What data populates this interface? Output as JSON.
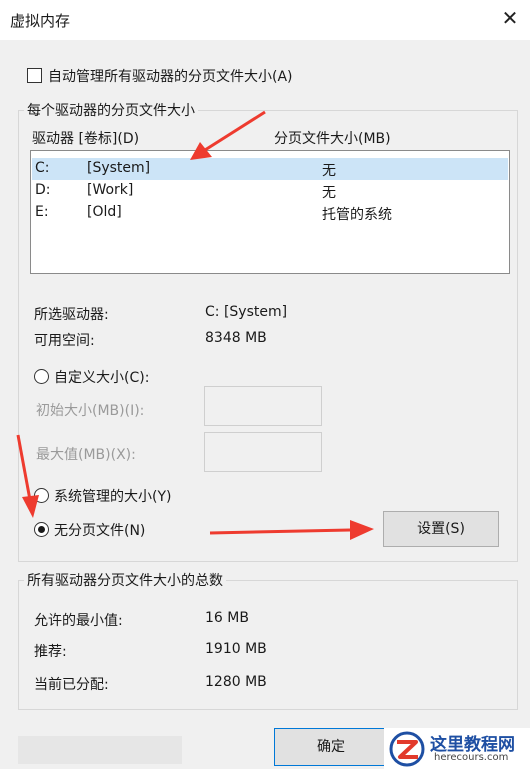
{
  "window": {
    "title": "虚拟内存",
    "close_glyph": "✕"
  },
  "auto_manage": {
    "label": "自动管理所有驱动器的分页文件大小(A)",
    "checked": false
  },
  "per_drive": {
    "legend": "每个驱动器的分页文件大小",
    "columns": {
      "drive": "驱动器 [卷标](D)",
      "size": "分页文件大小(MB)"
    },
    "drives": [
      {
        "letter": "C:",
        "label": "[System]",
        "size": "无",
        "selected": true
      },
      {
        "letter": "D:",
        "label": "[Work]",
        "size": "无",
        "selected": false
      },
      {
        "letter": "E:",
        "label": "[Old]",
        "size": "托管的系统",
        "selected": false
      }
    ],
    "selected_drive": {
      "label": "所选驱动器:",
      "value": "C:  [System]"
    },
    "free_space": {
      "label": "可用空间:",
      "value": "8348 MB"
    },
    "options": {
      "custom": {
        "label": "自定义大小(C):",
        "selected": false
      },
      "initial": {
        "label": "初始大小(MB)(I):"
      },
      "maximum": {
        "label": "最大值(MB)(X):"
      },
      "system_managed": {
        "label": "系统管理的大小(Y)",
        "selected": false
      },
      "no_paging": {
        "label": "无分页文件(N)",
        "selected": true
      }
    },
    "set_button": "设置(S)"
  },
  "totals": {
    "legend": "所有驱动器分页文件大小的总数",
    "min_allowed": {
      "label": "允许的最小值:",
      "value": "16 MB"
    },
    "recommended": {
      "label": "推荐:",
      "value": "1910 MB"
    },
    "current": {
      "label": "当前已分配:",
      "value": "1280 MB"
    }
  },
  "ok_button": "确定",
  "watermark": {
    "title": "这里教程网",
    "url": "herecours.com"
  },
  "colors": {
    "selection": "#cce4f7",
    "arrow": "#ee3b2f",
    "focus_border": "#0078d7"
  }
}
